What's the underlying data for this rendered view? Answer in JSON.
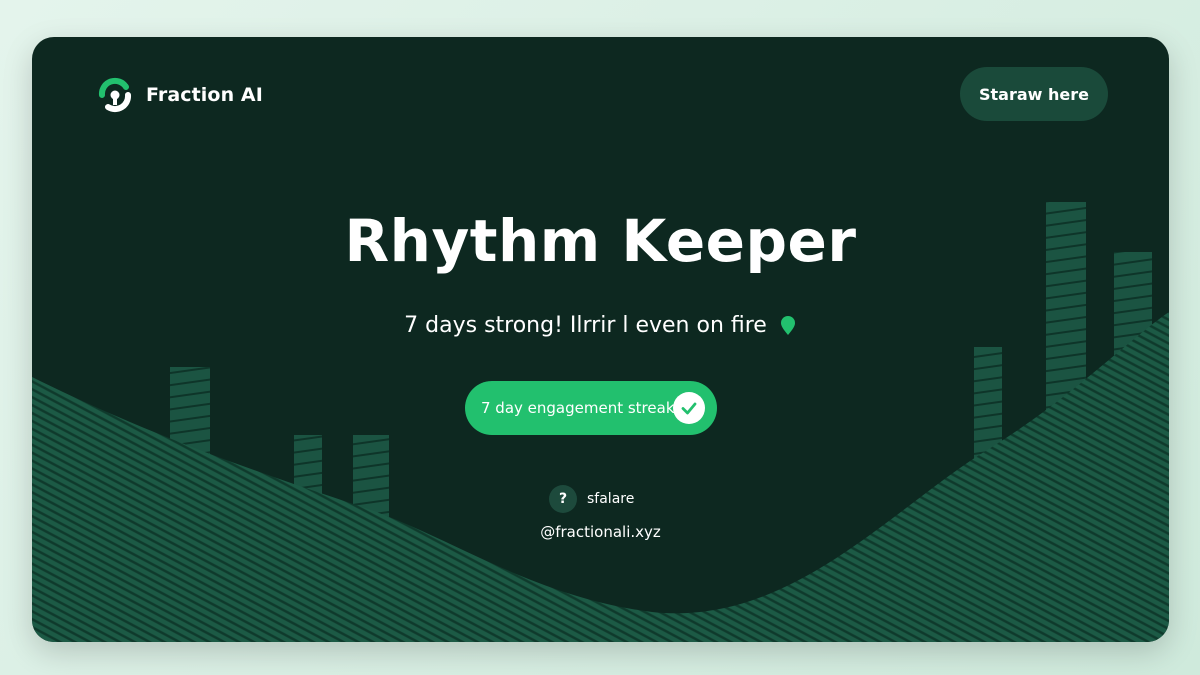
{
  "brand": {
    "name": "Fraction AI",
    "icon": "fraction-logo-icon",
    "accent": "#22c06e"
  },
  "header": {
    "cta_label": "Starаw here"
  },
  "main": {
    "title": "Rhythm Keeper",
    "subtitle": "7 days strong! Ilrrir l even on fire",
    "subtitle_icon": "location-pin-icon",
    "streak_badge": {
      "label": "7 day engagement streak",
      "icon": "check-icon"
    },
    "share": {
      "icon": "question-mark-icon",
      "label": "sfalare"
    },
    "handle": "@fractionali.xyz"
  },
  "colors": {
    "card_bg": "#0d2820",
    "button_bg": "#1a4a3a",
    "wave": "#1c5a45",
    "page_bg": "#dff1e7"
  }
}
